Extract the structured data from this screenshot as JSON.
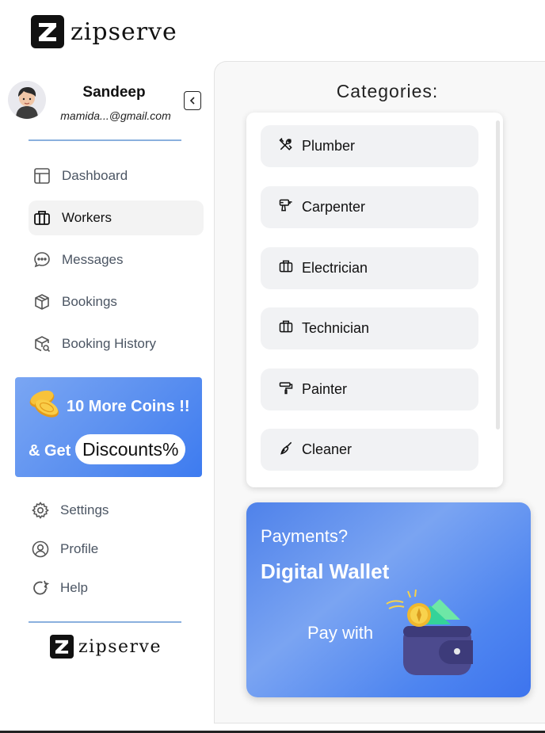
{
  "brand": {
    "name": "zipserve",
    "logo_letter": "Z"
  },
  "profile": {
    "name": "Sandeep",
    "email": "mamida...@gmail.com"
  },
  "nav": {
    "items": [
      {
        "label": "Dashboard",
        "icon": "layout-icon",
        "active": false
      },
      {
        "label": "Workers",
        "icon": "briefcase-icon",
        "active": true
      },
      {
        "label": "Messages",
        "icon": "chat-icon",
        "active": false
      },
      {
        "label": "Bookings",
        "icon": "package-icon",
        "active": false
      },
      {
        "label": "Booking History",
        "icon": "package-search-icon",
        "active": false
      }
    ],
    "secondary": [
      {
        "label": "Settings",
        "icon": "gear-icon"
      },
      {
        "label": "Profile",
        "icon": "user-circle-icon"
      },
      {
        "label": "Help",
        "icon": "help-refresh-icon"
      }
    ]
  },
  "promo": {
    "line1": "10 More Coins !!",
    "line2": "& Get",
    "pill": "Discounts%"
  },
  "categories": {
    "title": "Categories:",
    "items": [
      {
        "label": "Plumber",
        "icon": "tools-icon"
      },
      {
        "label": "Carpenter",
        "icon": "drill-icon"
      },
      {
        "label": "Electrician",
        "icon": "briefcase-icon"
      },
      {
        "label": "Technician",
        "icon": "briefcase-icon"
      },
      {
        "label": "Painter",
        "icon": "paint-roller-icon"
      },
      {
        "label": "Cleaner",
        "icon": "broom-icon"
      }
    ]
  },
  "wallet": {
    "question": "Payments?",
    "title": "Digital Wallet",
    "cta": "Pay with"
  },
  "colors": {
    "accent": "#5a8ff0",
    "divider": "#8ab0de",
    "active_bg": "#f3f3f3"
  }
}
